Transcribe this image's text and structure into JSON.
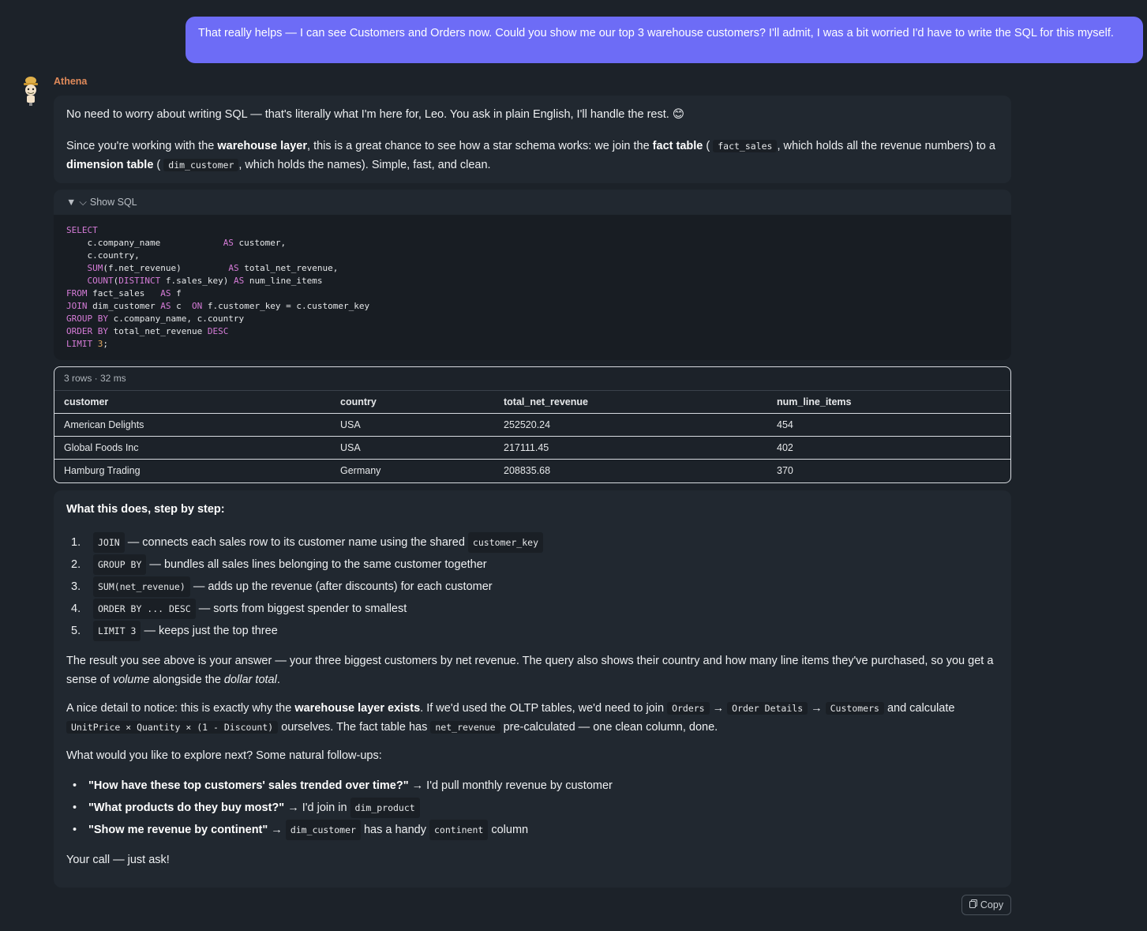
{
  "user_message": "That really helps — I can see Customers and Orders now. Could you show me our top 3 warehouse customers? I'll admit, I was a bit worried I'd have to write the SQL for this myself.",
  "assistant": {
    "name": "Athena",
    "intro_p1": "No need to worry about writing SQL — that's literally what I'm here for, Leo. You ask in plain English, I'll handle the rest. 😊",
    "intro_p2": {
      "t1": "Since you're working with the ",
      "b1": "warehouse layer",
      "t2": ", this is a great chance to see how a star schema works: we join the ",
      "b2": "fact table",
      "t3": " (",
      "c1": "fact_sales",
      "t4": ", which holds all the revenue numbers) to a ",
      "b3": "dimension table",
      "t5": " (",
      "c2": "dim_customer",
      "t6": ", which holds the names). Simple, fast, and clean."
    }
  },
  "sql": {
    "toggle_label": "Show SQL",
    "lines": [
      [
        "SELECT"
      ],
      [
        "    c.company_name            ",
        "AS",
        " customer,"
      ],
      [
        "    c.country,"
      ],
      [
        "    ",
        "SUM",
        "(f.net_revenue)         ",
        "AS",
        " total_net_revenue,"
      ],
      [
        "    ",
        "COUNT",
        "(",
        "DISTINCT",
        " f.sales_key) ",
        "AS",
        " num_line_items"
      ],
      [
        "FROM",
        " fact_sales   ",
        "AS",
        " f"
      ],
      [
        "JOIN",
        " dim_customer ",
        "AS",
        " c  ",
        "ON",
        " f.customer_key = c.customer_key"
      ],
      [
        "GROUP BY",
        " c.company_name, c.country"
      ],
      [
        "ORDER BY",
        " total_net_revenue ",
        "DESC"
      ],
      [
        "LIMIT",
        " ",
        "3",
        ";"
      ]
    ]
  },
  "result": {
    "meta": "3 rows · 32 ms",
    "columns": [
      "customer",
      "country",
      "total_net_revenue",
      "num_line_items"
    ],
    "rows": [
      [
        "American Delights",
        "USA",
        "252520.24",
        "454"
      ],
      [
        "Global Foods Inc",
        "USA",
        "217111.45",
        "402"
      ],
      [
        "Hamburg Trading",
        "Germany",
        "208835.68",
        "370"
      ]
    ]
  },
  "explain": {
    "heading": "What this does, step by step:",
    "steps": [
      {
        "n": "1.",
        "code": "JOIN",
        "text": "— connects each sales row to its customer name using the shared",
        "code2": "customer_key"
      },
      {
        "n": "2.",
        "code": "GROUP BY",
        "text": "— bundles all sales lines belonging to the same customer together",
        "code2": ""
      },
      {
        "n": "3.",
        "code": "SUM(net_revenue)",
        "text": "— adds up the revenue (after discounts) for each customer",
        "code2": ""
      },
      {
        "n": "4.",
        "code": "ORDER BY ... DESC",
        "text": "— sorts from biggest spender to smallest",
        "code2": ""
      },
      {
        "n": "5.",
        "code": "LIMIT 3",
        "text": "— keeps just the top three",
        "code2": ""
      }
    ],
    "p1": {
      "t1": "The result you see above is your answer — your three biggest customers by net revenue. The query also shows their country and how many line items they've purchased, so you get a sense of ",
      "i1": "volume",
      "t2": " alongside the ",
      "i2": "dollar total",
      "t3": "."
    },
    "p2": {
      "t1": "A nice detail to notice: this is exactly why the ",
      "b1": "warehouse layer exists",
      "t2": ". If we'd used the OLTP tables, we'd need to join ",
      "c1": "Orders",
      "c2": "Order Details",
      "c3": "Customers",
      "t3": " and calculate ",
      "c4": "UnitPrice × Quantity × (1 - Discount)",
      "t4": " ourselves. The fact table has ",
      "c5": "net_revenue",
      "t5": " pre-calculated — one clean column, done."
    },
    "p3": "What would you like to explore next? Some natural follow-ups:",
    "followups": [
      {
        "q": "\"How have these top customers' sales trended over time?\"",
        "t1": "I'd pull monthly revenue by customer",
        "c1": "",
        "t2": "",
        "c2": "",
        "t3": ""
      },
      {
        "q": "\"What products do they buy most?\"",
        "t1": "I'd join in",
        "c1": "dim_product",
        "t2": "",
        "c2": "",
        "t3": ""
      },
      {
        "q": "\"Show me revenue by continent\"",
        "t1": "",
        "c1": "dim_customer",
        "t2": "has a handy",
        "c2": "continent",
        "t3": "column"
      }
    ],
    "closing": "Your call — just ask!"
  },
  "copy_label": "Copy",
  "colors": {
    "user_bubble": "#6d6cf6",
    "assistant_name": "#e08a5a",
    "keyword": "#d67cd8",
    "number": "#e0a860"
  }
}
